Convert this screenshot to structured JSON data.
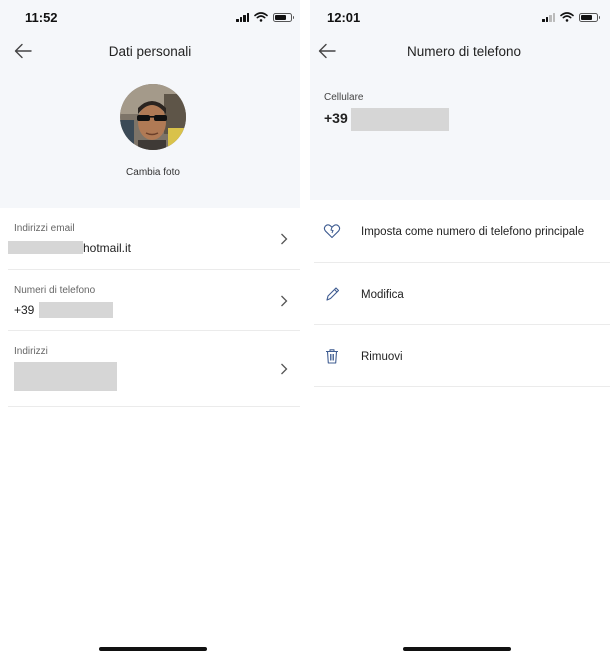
{
  "left": {
    "status": {
      "time": "11:52"
    },
    "nav": {
      "title": "Dati personali"
    },
    "profile": {
      "change_photo_label": "Cambia foto"
    },
    "rows": [
      {
        "label": "Indirizzi email",
        "value": "hotmail.it"
      },
      {
        "label": "Numeri di telefono",
        "value": "+39"
      },
      {
        "label": "Indirizzi",
        "value": ""
      }
    ]
  },
  "right": {
    "status": {
      "time": "12:01"
    },
    "nav": {
      "title": "Numero di telefono"
    },
    "phone": {
      "label": "Cellulare",
      "prefix": "+39"
    },
    "actions": [
      {
        "label": "Imposta come numero di telefono principale",
        "icon": "heart-icon"
      },
      {
        "label": "Modifica",
        "icon": "pencil-icon"
      },
      {
        "label": "Rimuovi",
        "icon": "trash-icon"
      }
    ]
  },
  "colors": {
    "header_bg": "#f5f7fa",
    "accent_icon": "#3f5c91",
    "divider": "#ebebeb",
    "redaction": "#d6d6d6"
  }
}
